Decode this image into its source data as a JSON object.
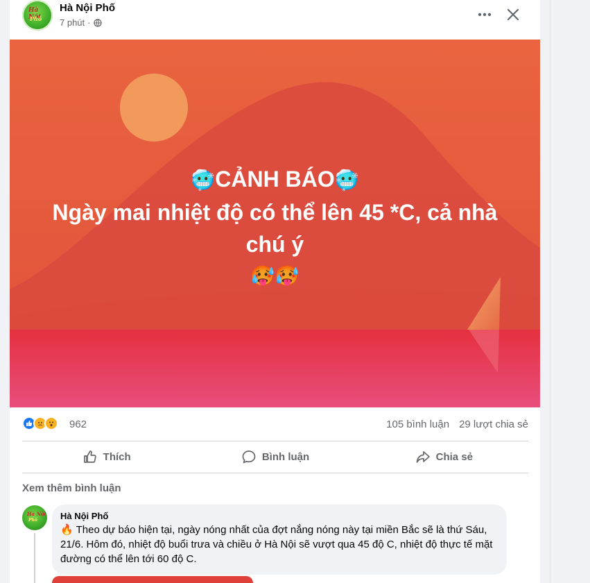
{
  "post": {
    "page_name": "Hà Nội Phố",
    "time": "7 phút",
    "time_separator": "·"
  },
  "banner": {
    "title": "CẢNH BÁO",
    "line1": "Ngày mai nhiệt độ có thể lên 45 *C, cả nhà",
    "line2": "chú ý",
    "cold_emoji": "🥶",
    "hot_emoji": "🥵🥵",
    "colors": {
      "sky": "#e2583e",
      "hill": "#dc4b3f",
      "sun": "#f0935a",
      "sea": "#e8345a"
    }
  },
  "reactions": {
    "count": "962",
    "icons": [
      "like",
      "sad",
      "wow"
    ],
    "comments": "105 bình luận",
    "shares": "29 lượt chia sẻ"
  },
  "actions": {
    "like": "Thích",
    "comment": "Bình luận",
    "share": "Chia sẻ"
  },
  "comments": {
    "see_more": "Xem thêm bình luận",
    "items": [
      {
        "author": "Hà Nội Phố",
        "emoji": "🔥",
        "text": "Theo dự báo hiện tại, ngày nóng nhất của đợt nắng nóng này tại miền Bắc sẽ là thứ Sáu, 21/6. Hôm đó, nhiệt độ buổi trưa và chiều ở Hà Nội sẽ vượt qua 45 độ C, nhiệt độ thực tế mặt đường có thể lên tới 60 độ C."
      }
    ]
  },
  "icons": {
    "more": "more-horizontal-icon",
    "close": "close-icon",
    "globe": "globe-icon",
    "like": "thumbs-up-icon",
    "comment": "speech-bubble-icon",
    "share": "share-arrow-icon"
  }
}
